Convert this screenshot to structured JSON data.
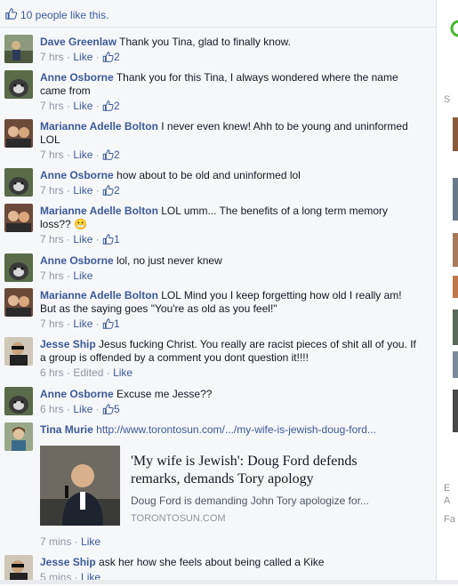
{
  "likes_summary": "10 people like this.",
  "comments": [
    {
      "author": "Dave Greenlaw",
      "text": "Thank you Tina, glad to finally know.",
      "time": "7 hrs",
      "like_label": "Like",
      "like_count": "2"
    },
    {
      "author": "Anne Osborne",
      "text": "Thank you for this Tina, I always wondered where the name came from",
      "time": "7 hrs",
      "like_label": "Like",
      "like_count": "2"
    },
    {
      "author": "Marianne Adelle Bolton",
      "text": "I never even knew! Ahh to be young and uninformed LOL",
      "time": "7 hrs",
      "like_label": "Like",
      "like_count": "2"
    },
    {
      "author": "Anne Osborne",
      "text": "how about to be old and uninformed lol",
      "time": "7 hrs",
      "like_label": "Like",
      "like_count": "2"
    },
    {
      "author": "Marianne Adelle Bolton",
      "text": "LOL umm... The benefits of a long term memory loss??",
      "emoji": "😬",
      "time": "7 hrs",
      "like_label": "Like",
      "like_count": "1"
    },
    {
      "author": "Anne Osborne",
      "text": "lol, no just never knew",
      "time": "7 hrs",
      "like_label": "Like"
    },
    {
      "author": "Marianne Adelle Bolton",
      "text": "LOL Mind you I keep forgetting how old I really am! But as the saying goes \"You're as old as you feel!\"",
      "time": "7 hrs",
      "like_label": "Like",
      "like_count": "1"
    },
    {
      "author": "Jesse Ship",
      "text": "Jesus fucking Christ. You really are racist pieces of shit all of you. If a group is offended by a comment you dont question it!!!!",
      "time": "6 hrs",
      "edited": "Edited",
      "like_label": "Like"
    },
    {
      "author": "Anne Osborne",
      "text": "Excuse me Jesse??",
      "time": "6 hrs",
      "like_label": "Like",
      "like_count": "5"
    },
    {
      "author": "Tina Murie",
      "url": "http://www.torontosun.com/.../my-wife-is-jewish-doug-ford...",
      "time": "7 mins",
      "like_label": "Like"
    },
    {
      "author": "Jesse Ship",
      "text": "ask her how she feels about being called a Kike",
      "time": "5 mins",
      "like_label": "Like"
    }
  ],
  "link_preview": {
    "title": "'My wife is Jewish': Doug Ford defends remarks, demands Tory apology",
    "description": "Doug Ford is demanding John Tory apologize for...",
    "domain": "TORONTOSUN.COM"
  },
  "right_column": {
    "letters": [
      "S",
      "E",
      "A",
      "Fa"
    ]
  },
  "colors": {
    "link": "#3b5998",
    "meta": "#9197a3",
    "feed_bg": "#f6f7f9"
  }
}
